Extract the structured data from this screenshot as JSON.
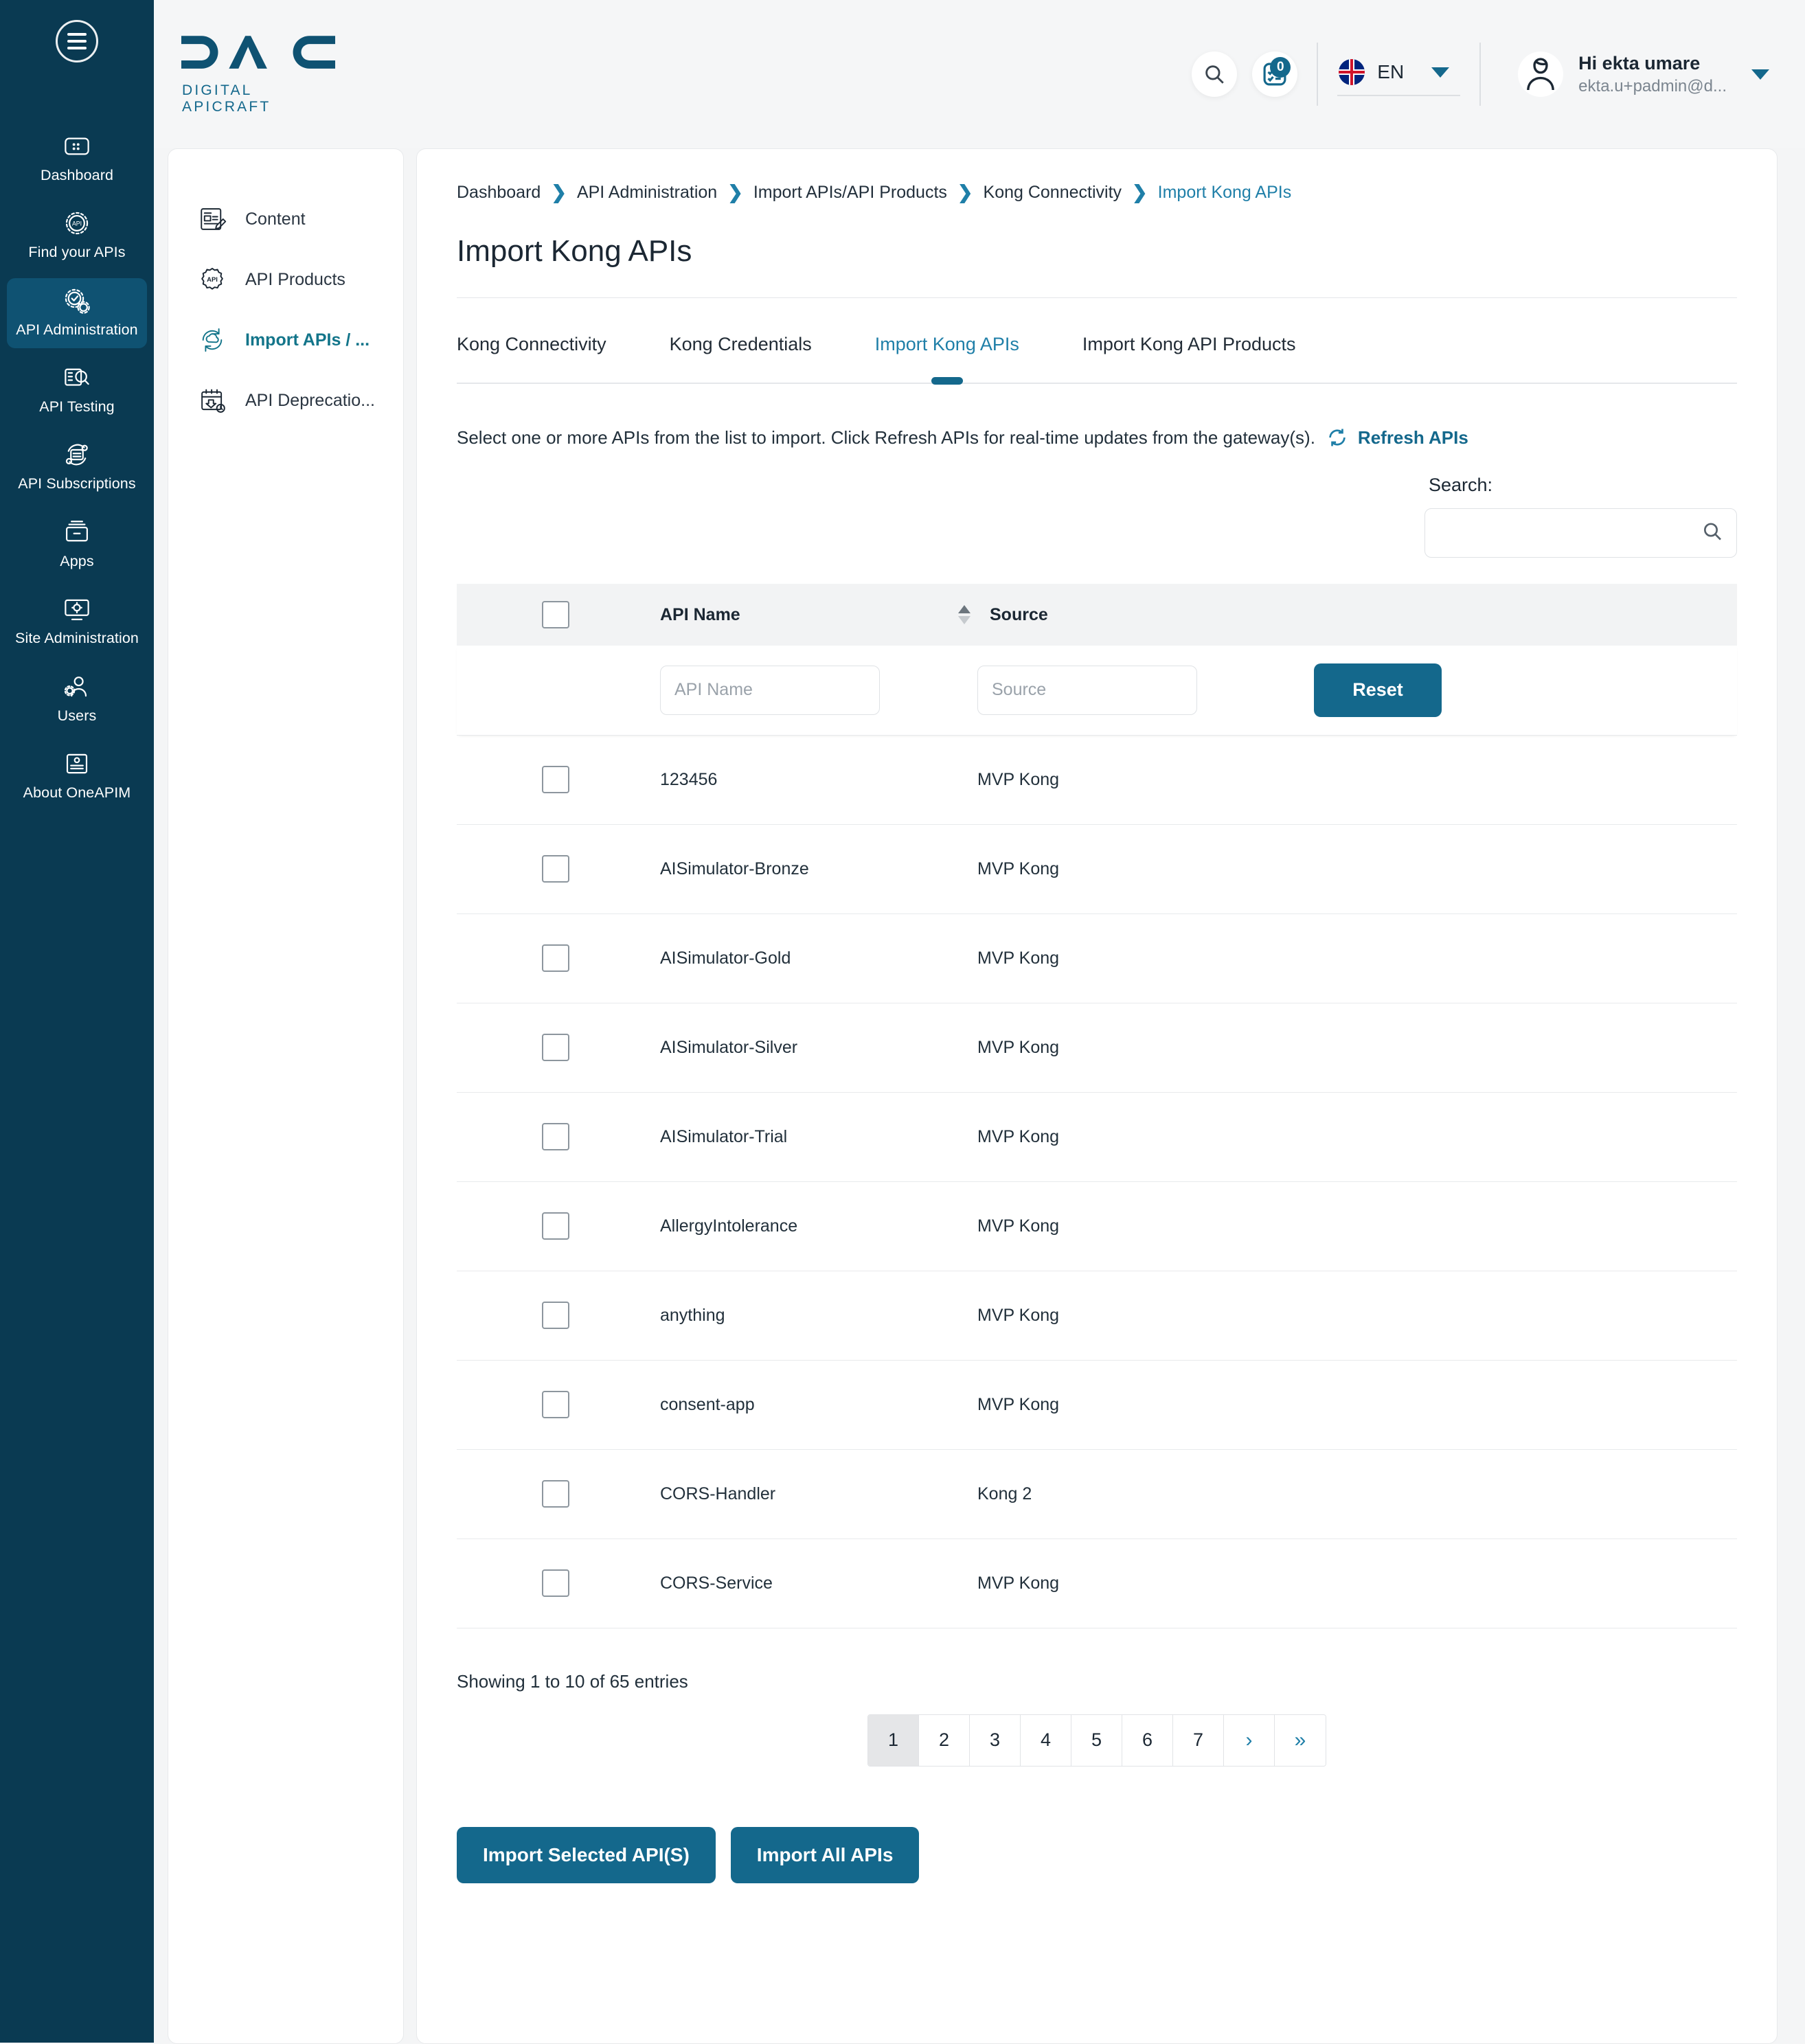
{
  "rail": {
    "menu_icon": "hamburger-icon",
    "items": [
      {
        "label": "Dashboard",
        "icon": "dashboard-icon",
        "active": false
      },
      {
        "label": "Find your APIs",
        "icon": "find-apis-icon",
        "active": false
      },
      {
        "label": "API Administration",
        "icon": "api-administration-icon",
        "active": true
      },
      {
        "label": "API Testing",
        "icon": "api-testing-icon",
        "active": false
      },
      {
        "label": "API Subscriptions",
        "icon": "api-subscriptions-icon",
        "active": false
      },
      {
        "label": "Apps",
        "icon": "apps-icon",
        "active": false
      },
      {
        "label": "Site Administration",
        "icon": "site-administration-icon",
        "active": false
      },
      {
        "label": "Users",
        "icon": "users-icon",
        "active": false
      },
      {
        "label": "About OneAPIM",
        "icon": "about-icon",
        "active": false
      }
    ]
  },
  "topbar": {
    "logo_main": "DAC",
    "logo_sub": "DIGITAL APICRAFT",
    "search_icon": "search-icon",
    "tasks_icon": "tasks-clipboard-icon",
    "tasks_badge": "0",
    "language": "EN",
    "flag_icon": "uk-flag-icon",
    "user_greeting": "Hi ekta umare",
    "user_email": "ekta.u+padmin@d...",
    "avatar_icon": "avatar-icon"
  },
  "subnav": {
    "items": [
      {
        "label": "Content",
        "icon": "content-icon",
        "active": false
      },
      {
        "label": "API Products",
        "icon": "api-products-icon",
        "active": false
      },
      {
        "label": "Import APIs / ...",
        "icon": "import-apis-icon",
        "active": true
      },
      {
        "label": "API Deprecatio...",
        "icon": "api-deprecation-icon",
        "active": false
      }
    ]
  },
  "main": {
    "breadcrumb": [
      "Dashboard",
      "API Administration",
      "Import APIs/API Products",
      "Kong Connectivity",
      "Import Kong APIs"
    ],
    "page_title": "Import Kong APIs",
    "tabs": [
      {
        "label": "Kong Connectivity",
        "active": false
      },
      {
        "label": "Kong Credentials",
        "active": false
      },
      {
        "label": "Import Kong APIs",
        "active": true
      },
      {
        "label": "Import Kong API Products",
        "active": false
      }
    ],
    "intro_text": "Select one or more APIs from the list to import. Click Refresh APIs for real-time updates from the gateway(s).",
    "refresh_label": "Refresh APIs",
    "refresh_icon": "refresh-icon",
    "search_label": "Search:",
    "search_value": "",
    "search_placeholder": "",
    "search_icon": "search-icon",
    "table": {
      "columns": [
        "API Name",
        "Source"
      ],
      "sort_column": "Source",
      "sort_direction": "asc",
      "filters": {
        "api_name_placeholder": "API Name",
        "api_name_value": "",
        "source_placeholder": "Source",
        "source_value": "",
        "reset_label": "Reset"
      },
      "rows": [
        {
          "name": "123456",
          "source": "MVP Kong",
          "checked": false
        },
        {
          "name": "AISimulator-Bronze",
          "source": "MVP Kong",
          "checked": false
        },
        {
          "name": "AISimulator-Gold",
          "source": "MVP Kong",
          "checked": false
        },
        {
          "name": "AISimulator-Silver",
          "source": "MVP Kong",
          "checked": false
        },
        {
          "name": "AISimulator-Trial",
          "source": "MVP Kong",
          "checked": false
        },
        {
          "name": "AllergyIntolerance",
          "source": "MVP Kong",
          "checked": false
        },
        {
          "name": "anything",
          "source": "MVP Kong",
          "checked": false
        },
        {
          "name": "consent-app",
          "source": "MVP Kong",
          "checked": false
        },
        {
          "name": "CORS-Handler",
          "source": "Kong 2",
          "checked": false
        },
        {
          "name": "CORS-Service",
          "source": "MVP Kong",
          "checked": false
        }
      ]
    },
    "showing_text": "Showing 1 to 10 of 65 entries",
    "pagination": {
      "pages": [
        "1",
        "2",
        "3",
        "4",
        "5",
        "6",
        "7"
      ],
      "current": "1",
      "next_label": "›",
      "last_label": "»"
    },
    "buttons": {
      "import_selected": "Import Selected API(S)",
      "import_all": "Import All APIs"
    }
  },
  "colors": {
    "rail_bg": "#0a3a52",
    "rail_active": "#0f5272",
    "accent": "#14688c",
    "link": "#1f7fa8",
    "page_bg": "#f4f5f6"
  }
}
